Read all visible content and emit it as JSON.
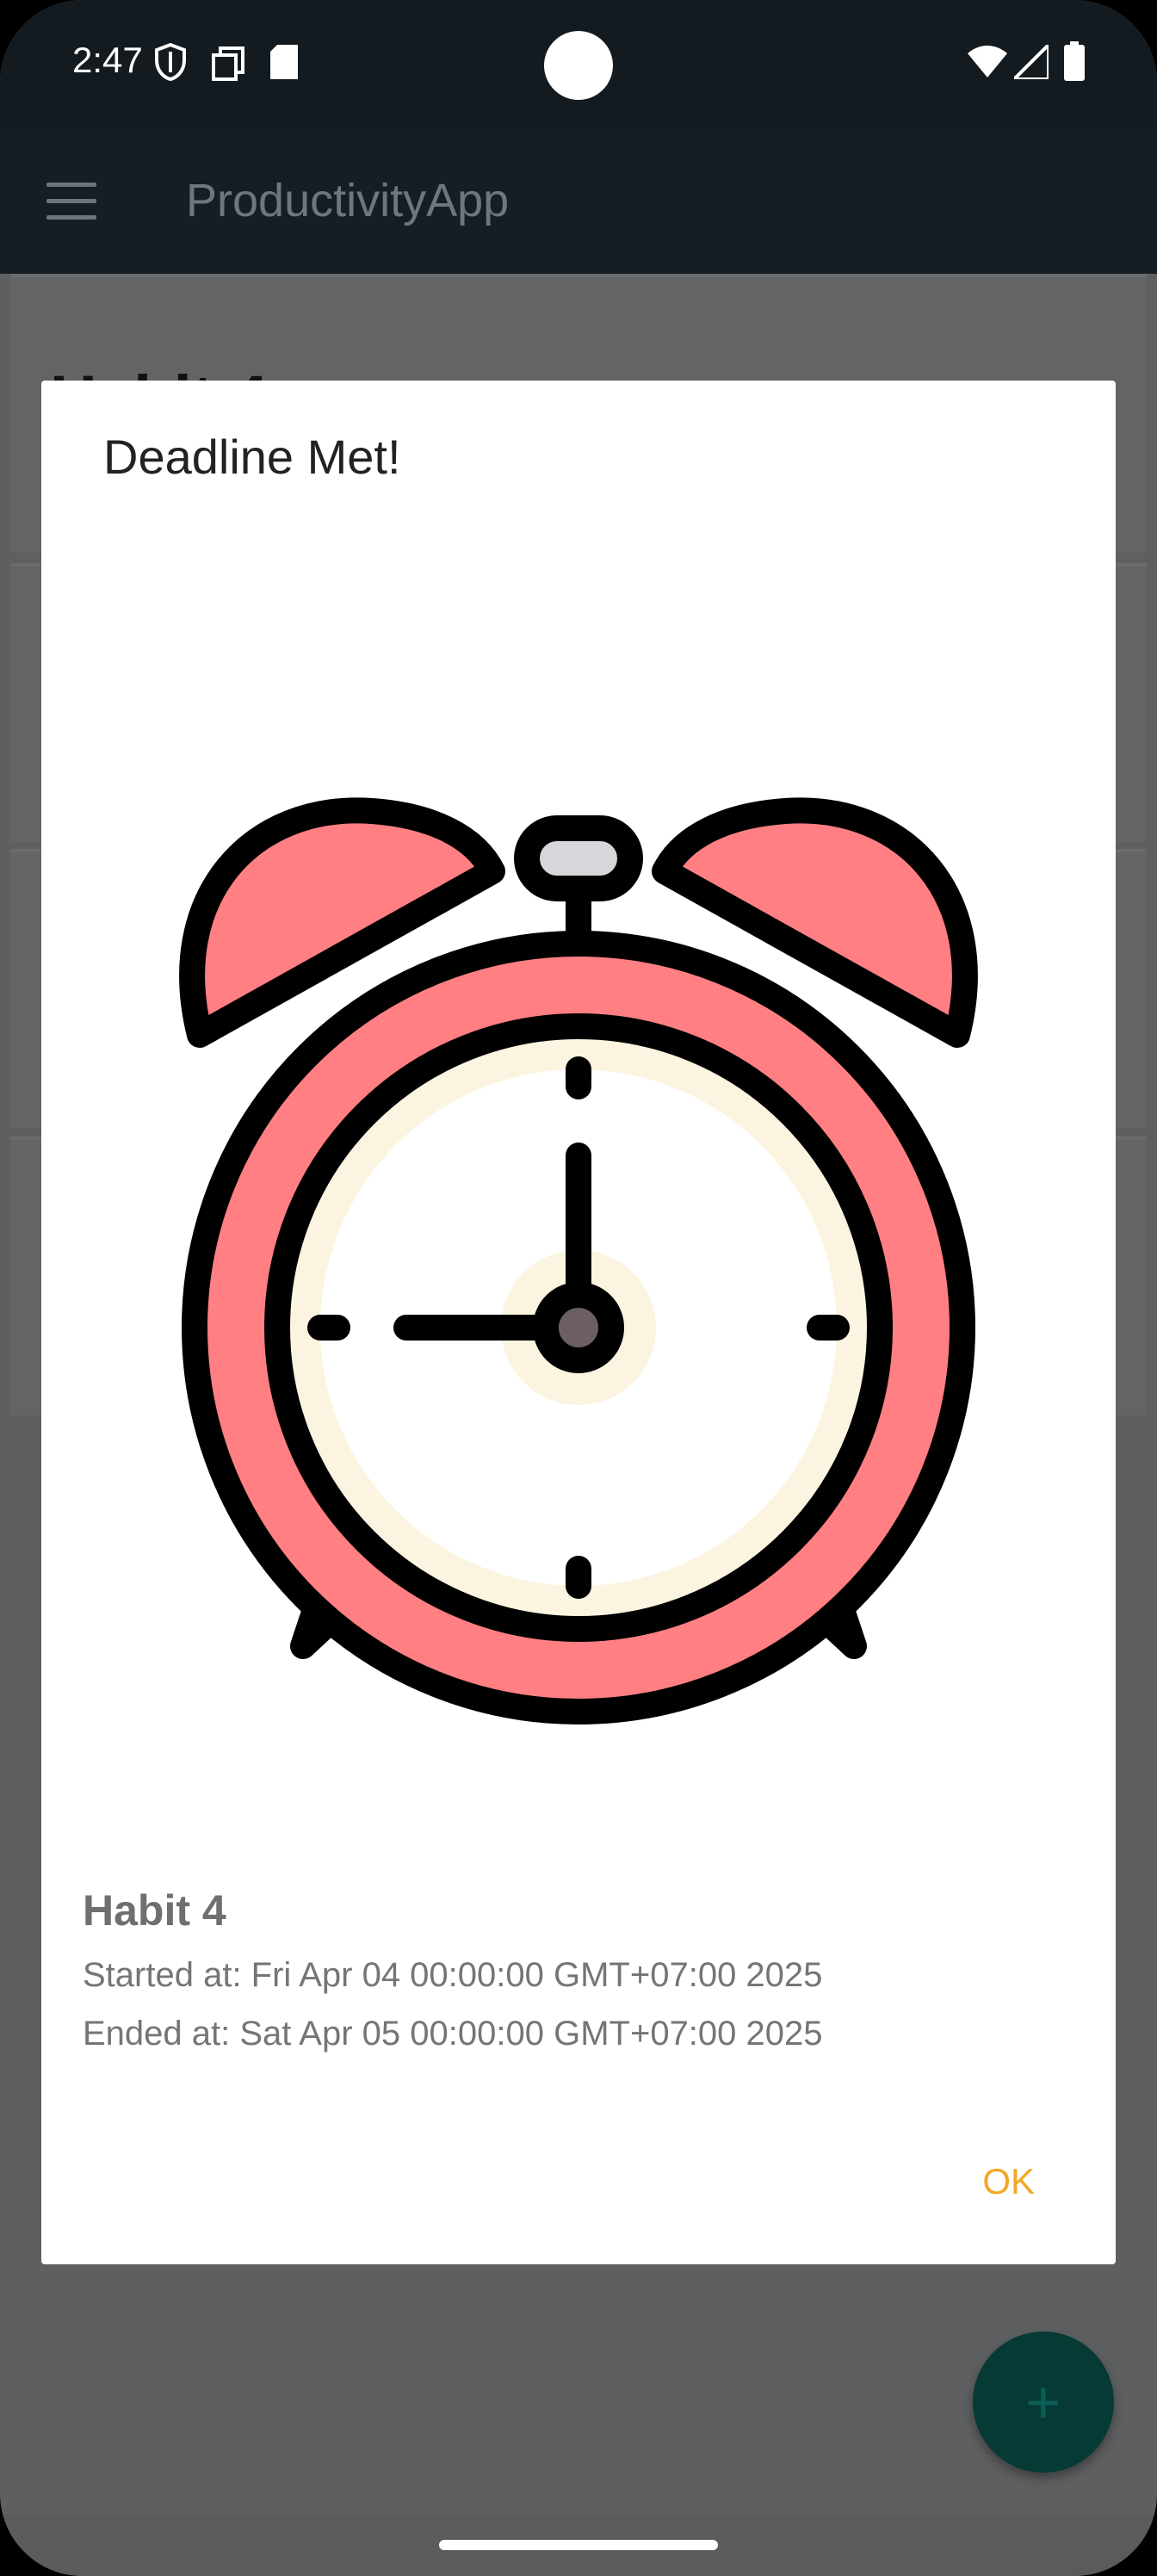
{
  "status_bar": {
    "time": "2:47"
  },
  "app_bar": {
    "title": "ProductivityApp"
  },
  "background": {
    "heading": "Habit 4"
  },
  "dialog": {
    "title": "Deadline Met!",
    "habit_name": "Habit 4",
    "started": "Started at: Fri Apr 04 00:00:00 GMT+07:00 2025",
    "ended": "Ended at: Sat Apr 05 00:00:00 GMT+07:00 2025",
    "ok_label": "OK",
    "image": "alarm-clock-icon"
  },
  "fab": {
    "icon": "plus-icon"
  },
  "colors": {
    "accent": "#f2a826",
    "clock_red": "#ff7f82",
    "clock_face": "#fbf4e0"
  }
}
